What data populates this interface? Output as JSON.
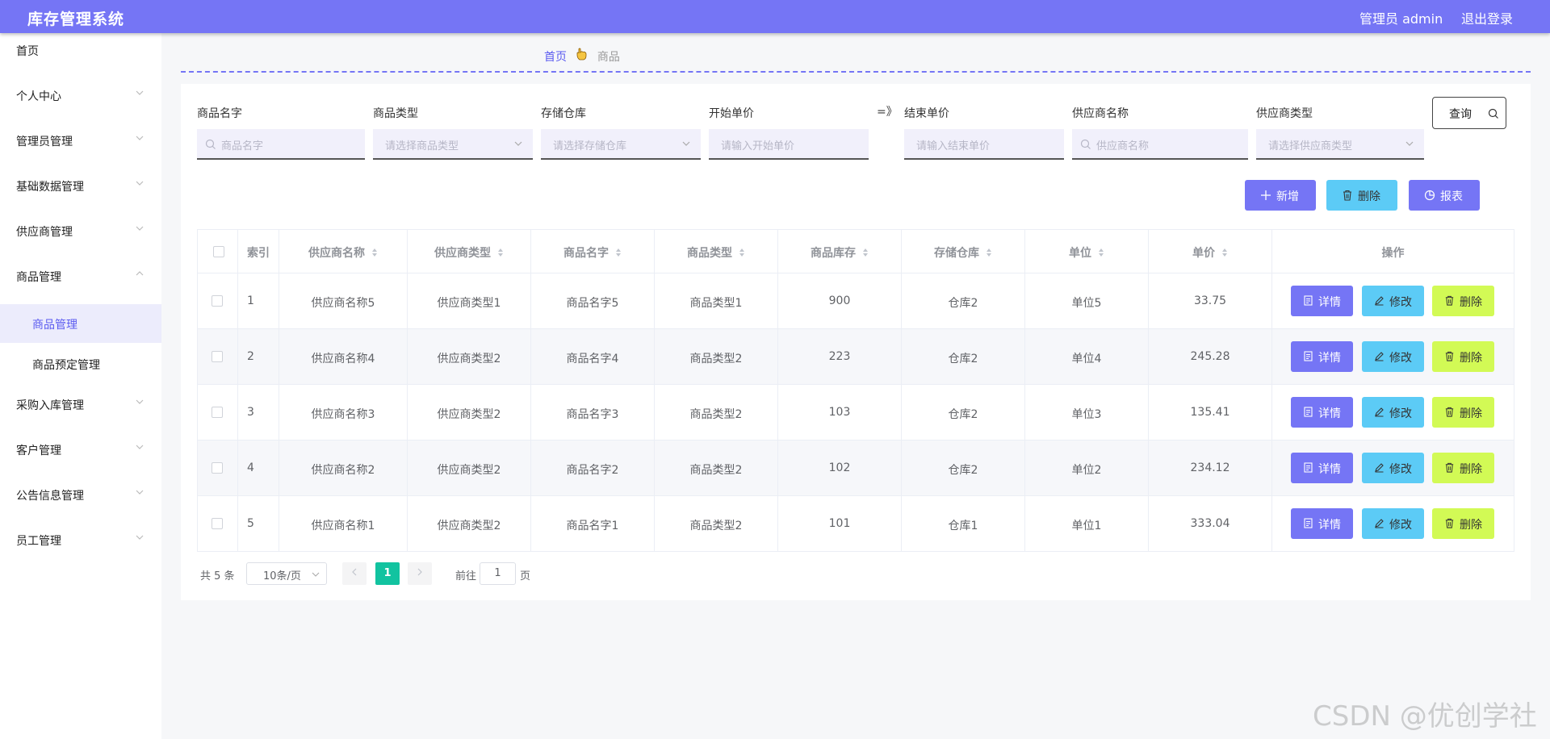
{
  "header": {
    "app_title": "库存管理系统",
    "user": "管理员 admin",
    "logout": "退出登录"
  },
  "sidebar": {
    "items": [
      {
        "label": "首页"
      },
      {
        "label": "个人中心"
      },
      {
        "label": "管理员管理"
      },
      {
        "label": "基础数据管理"
      },
      {
        "label": "供应商管理"
      },
      {
        "label": "商品管理"
      },
      {
        "label": "采购入库管理"
      },
      {
        "label": "客户管理"
      },
      {
        "label": "公告信息管理"
      },
      {
        "label": "员工管理"
      }
    ],
    "sub_items": [
      {
        "label": "商品管理",
        "active": true
      },
      {
        "label": "商品预定管理",
        "active": false
      }
    ]
  },
  "breadcrumb": {
    "home": "首页",
    "sep_icon": "hand-icon",
    "current": "商品"
  },
  "filters": {
    "goods_name": {
      "label": "商品名字",
      "placeholder": "商品名字"
    },
    "goods_type": {
      "label": "商品类型",
      "placeholder": "请选择商品类型"
    },
    "warehouse": {
      "label": "存储仓库",
      "placeholder": "请选择存储仓库"
    },
    "start_price": {
      "label": "开始单价",
      "placeholder": "请输入开始单价"
    },
    "arrow": "=》",
    "end_price": {
      "label": "结束单价",
      "placeholder": "请输入结束单价"
    },
    "supplier_name": {
      "label": "供应商名称",
      "placeholder": "供应商名称"
    },
    "supplier_type": {
      "label": "供应商类型",
      "placeholder": "请选择供应商类型"
    },
    "query_label": "查询"
  },
  "toolbar": {
    "add_label": "新增",
    "delete_label": "删除",
    "report_label": "报表",
    "accent": "#7575f5",
    "delete_color": "#5ccbf6"
  },
  "table": {
    "headers": [
      "索引",
      "供应商名称",
      "供应商类型",
      "商品名字",
      "商品类型",
      "商品库存",
      "存储仓库",
      "单位",
      "单价",
      "操作"
    ],
    "rows": [
      [
        "1",
        "供应商名称5",
        "供应商类型1",
        "商品名字5",
        "商品类型1",
        "900",
        "仓库2",
        "单位5",
        "33.75"
      ],
      [
        "2",
        "供应商名称4",
        "供应商类型2",
        "商品名字4",
        "商品类型2",
        "223",
        "仓库2",
        "单位4",
        "245.28"
      ],
      [
        "3",
        "供应商名称3",
        "供应商类型2",
        "商品名字3",
        "商品类型2",
        "103",
        "仓库2",
        "单位3",
        "135.41"
      ],
      [
        "4",
        "供应商名称2",
        "供应商类型2",
        "商品名字2",
        "商品类型2",
        "102",
        "仓库2",
        "单位2",
        "234.12"
      ],
      [
        "5",
        "供应商名称1",
        "供应商类型2",
        "商品名字1",
        "商品类型2",
        "101",
        "仓库1",
        "单位1",
        "333.04"
      ]
    ],
    "actions": {
      "detail": "详情",
      "edit": "修改",
      "delete": "删除"
    }
  },
  "pagination": {
    "total": "共 5 条",
    "page_size": "10条/页",
    "current_page": "1",
    "goto_label": "前往",
    "goto_value": "1",
    "page_suffix": "页"
  },
  "watermark": "CSDN @优创学社"
}
